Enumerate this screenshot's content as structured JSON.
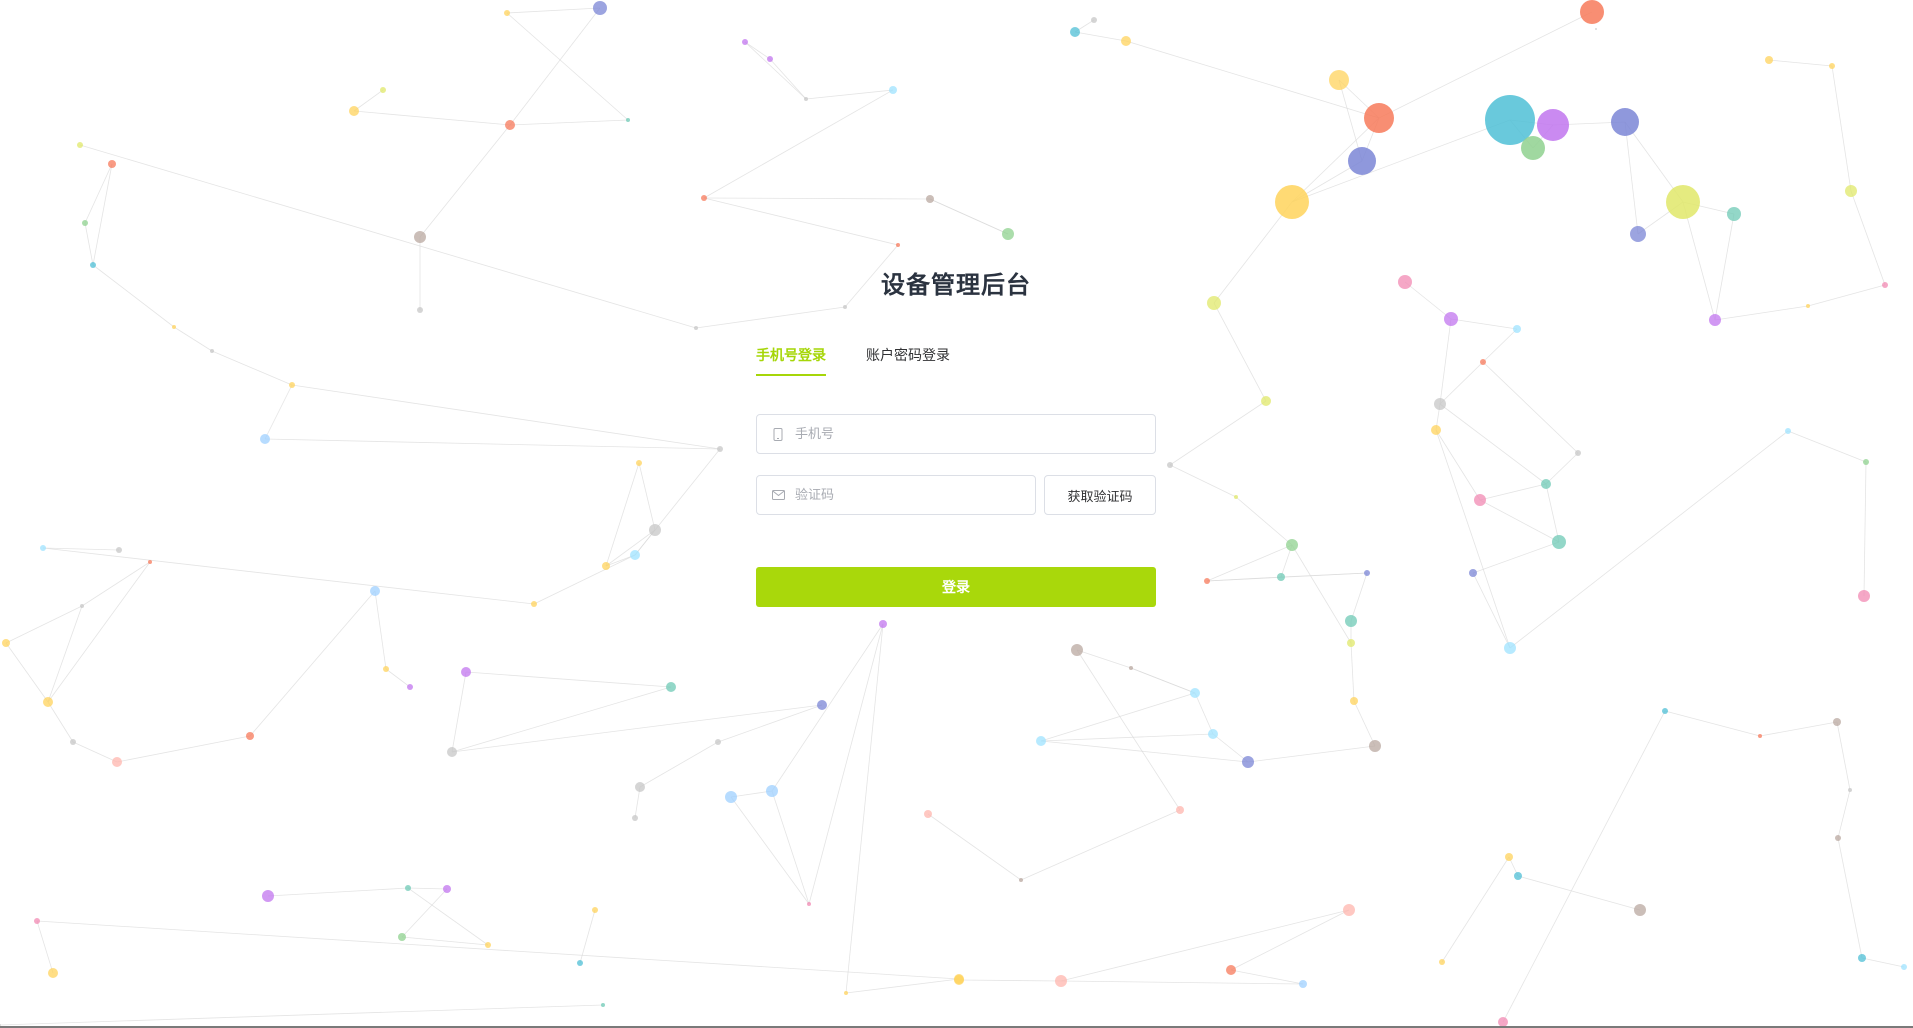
{
  "login": {
    "title": "设备管理后台",
    "tabs": [
      {
        "label": "手机号登录",
        "active": true
      },
      {
        "label": "账户密码登录",
        "active": false
      }
    ],
    "phone": {
      "placeholder": "手机号",
      "value": "",
      "icon": "phone-icon"
    },
    "code": {
      "placeholder": "验证码",
      "value": "",
      "icon": "mail-icon"
    },
    "get_code_label": "获取验证码",
    "submit_label": "登录"
  },
  "colors": {
    "accent": "#a9d80b",
    "title": "#2b3340",
    "border": "#dcdfe6",
    "particles": [
      "#ffd35c",
      "#f77a5b",
      "#7b86d6",
      "#4fbfd6",
      "#c176ef",
      "#8fd18f",
      "#e0e86a",
      "#6fcab6",
      "#b9a8a0",
      "#f28ab3",
      "#9fd0ff",
      "#ffb6ad",
      "#c7c7c7",
      "#9fe3ff"
    ]
  },
  "background": {
    "type": "particle-network"
  }
}
